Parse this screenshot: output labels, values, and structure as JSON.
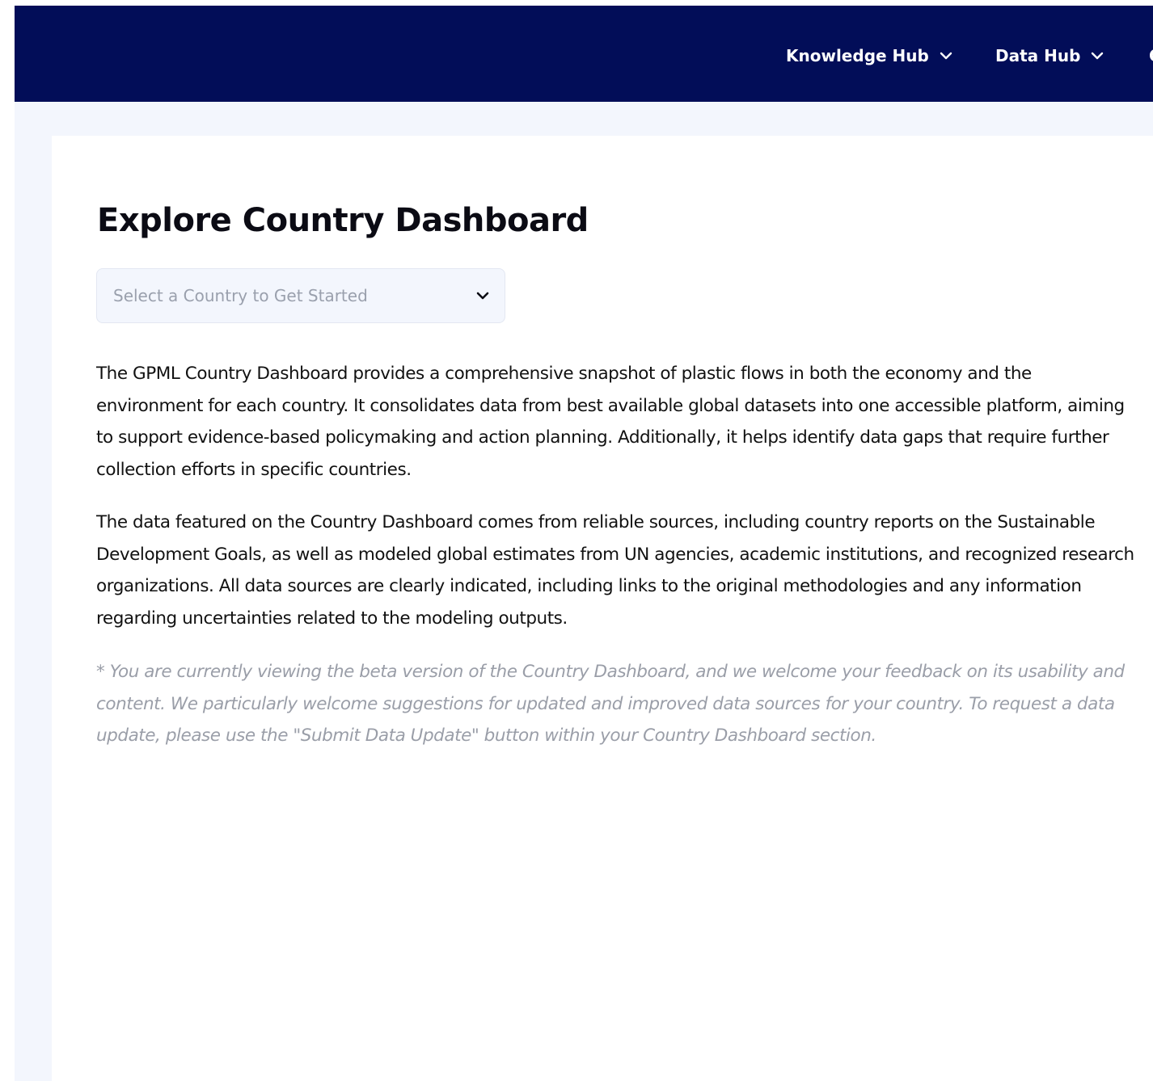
{
  "nav": {
    "items": [
      {
        "label": "Knowledge Hub"
      },
      {
        "label": "Data Hub"
      }
    ],
    "cutoff_label": "C"
  },
  "main": {
    "title": "Explore Country Dashboard",
    "country_select": {
      "placeholder": "Select a Country to Get Started"
    },
    "paragraphs": [
      "The GPML Country Dashboard provides a comprehensive snapshot of plastic flows in both the economy and the environment for each country. It consolidates data from best available global datasets into one accessible platform, aiming to support evidence-based policymaking and action planning. Additionally, it helps identify data gaps that require further collection efforts in specific countries.",
      "The data featured on the Country Dashboard comes from reliable sources, including country reports on the Sustainable Development Goals, as well as modeled global estimates from UN agencies, academic institutions, and recognized research organizations. All data sources are clearly indicated, including links to the original methodologies and any information regarding uncertainties related to the modeling outputs."
    ],
    "note": "* You are currently viewing the beta version of the Country Dashboard, and we welcome your feedback on its usability and content. We particularly welcome suggestions for updated and improved data sources for your country. To request a data update, please use the \"Submit Data Update\" button within your Country Dashboard section."
  },
  "colors": {
    "navbar": "#020d58",
    "page_background": "#f3f6fd",
    "card": "#ffffff",
    "text": "#111111",
    "muted_text": "#9a9ea8"
  },
  "icons": {
    "nav_dropdown": "chevron-down-icon",
    "select_dropdown": "chevron-down-icon"
  }
}
